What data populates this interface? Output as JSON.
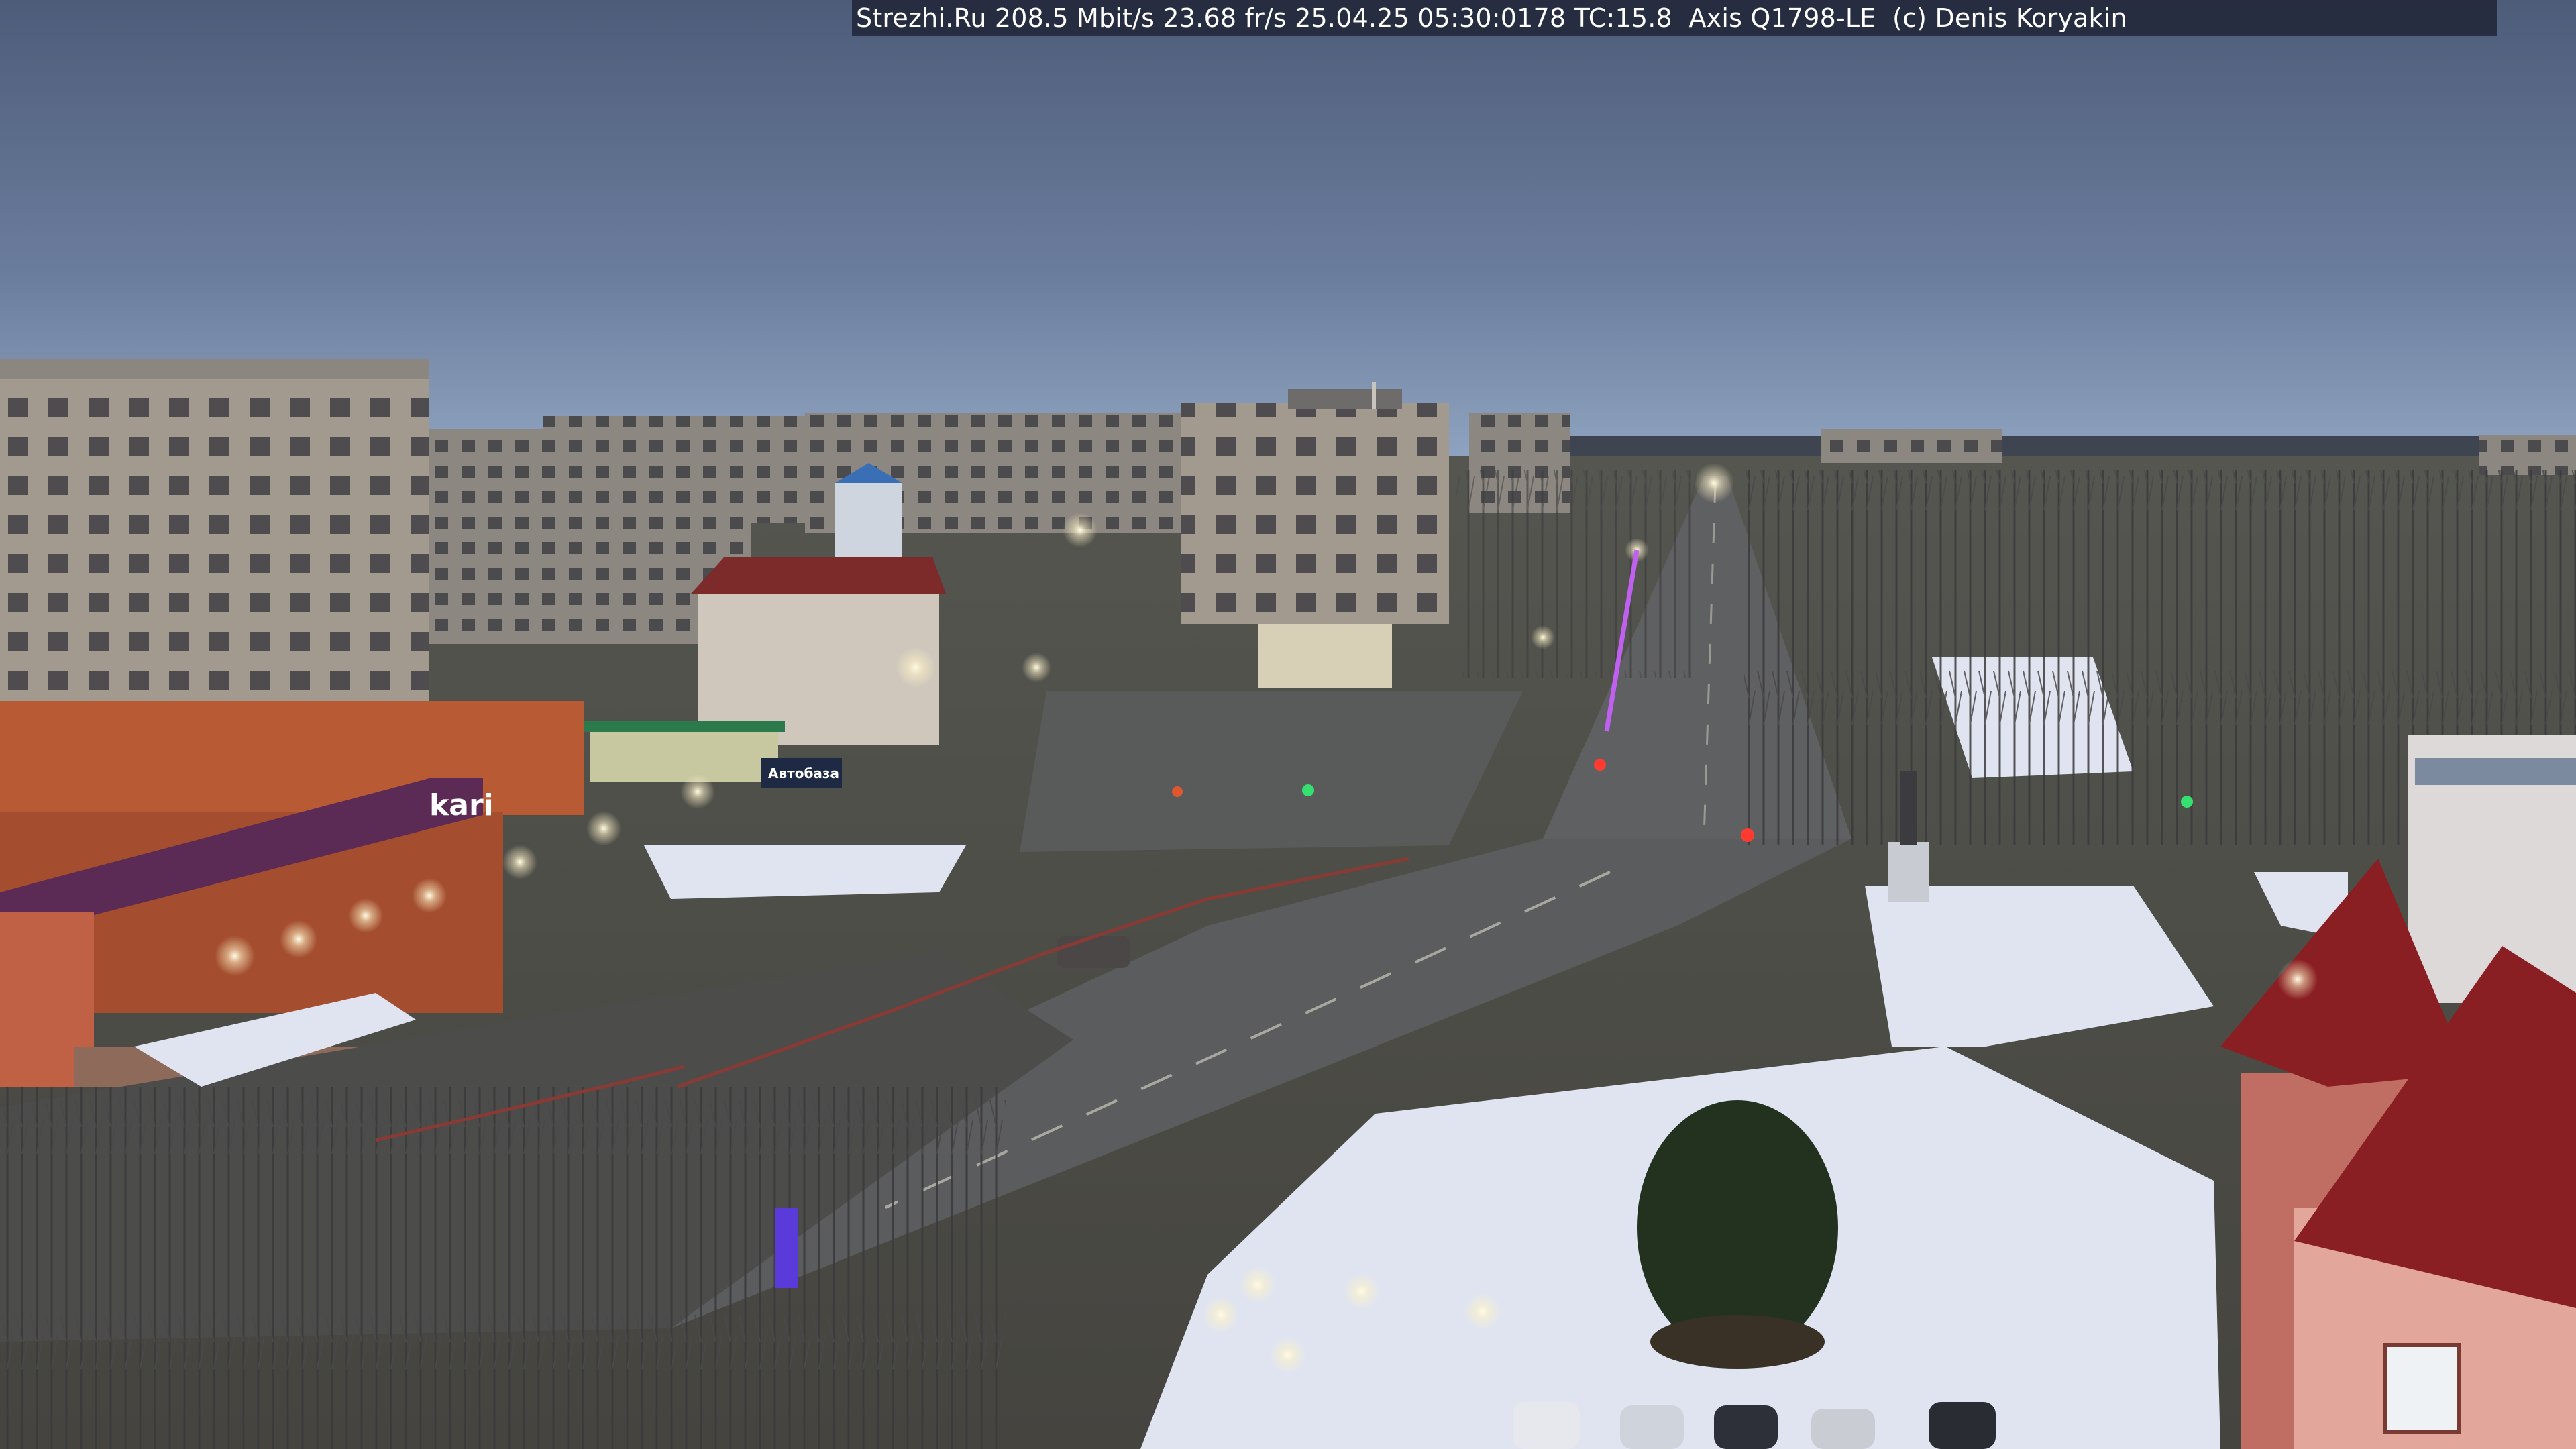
{
  "camera_overlay": {
    "text": "Strezhi.Ru 208.5 Mbit/s 23.68 fr/s 25.04.25 05:30:0178 TC:15.8  Axis Q1798-LE  (c) Denis Koryakin"
  },
  "signs": {
    "store_sign": "kari",
    "shop_sign_small": "Автобаза"
  },
  "colors": {
    "sky_top": "#52637f",
    "sky_horizon": "#8ea3bf",
    "road": "#5f6062",
    "snow": "#dfe4f0",
    "streetlight": "#fff6d8"
  }
}
